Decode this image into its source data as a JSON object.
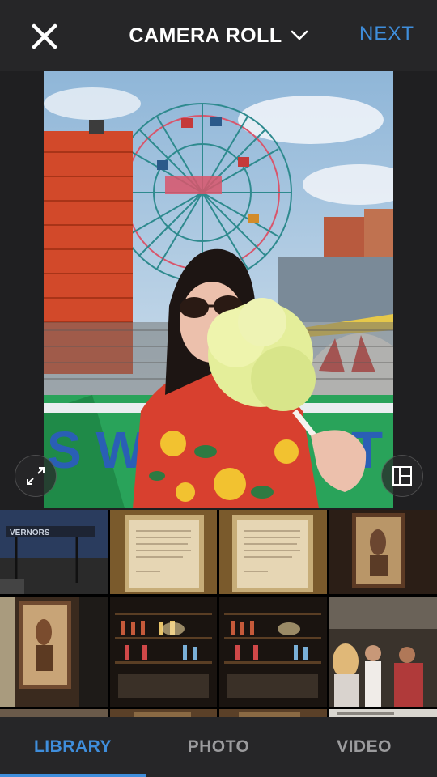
{
  "header": {
    "title": "CAMERA ROLL",
    "next_label": "NEXT",
    "close_icon": "close-icon",
    "dropdown_icon": "chevron-down-icon"
  },
  "preview": {
    "expand_icon": "expand-icon",
    "layout_icon": "layout-icon"
  },
  "tabs": [
    {
      "label": "LIBRARY",
      "active": true
    },
    {
      "label": "PHOTO",
      "active": false
    },
    {
      "label": "VIDEO",
      "active": false
    }
  ],
  "colors": {
    "accent": "#3f8edc",
    "bar_bg": "#262628",
    "inactive_tab": "#9b9b9d"
  }
}
